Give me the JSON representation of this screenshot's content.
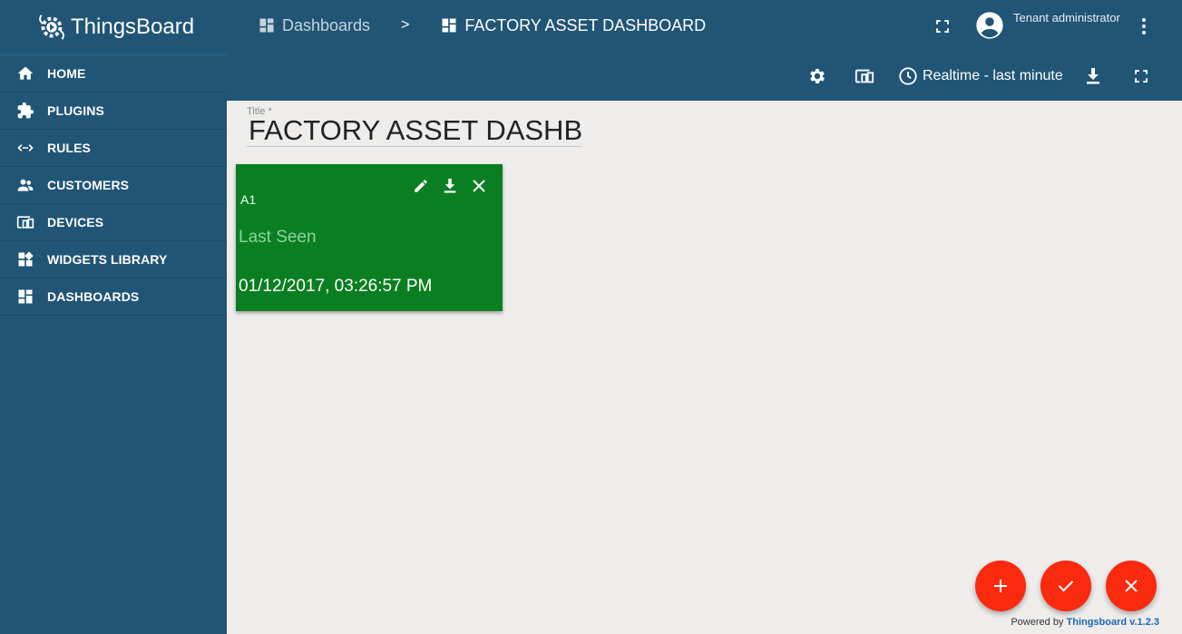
{
  "app": {
    "name": "ThingsBoard"
  },
  "sidebar": {
    "items": [
      {
        "label": "HOME",
        "icon": "home-icon"
      },
      {
        "label": "PLUGINS",
        "icon": "puzzle-icon"
      },
      {
        "label": "RULES",
        "icon": "code-arrows-icon"
      },
      {
        "label": "CUSTOMERS",
        "icon": "people-icon"
      },
      {
        "label": "DEVICES",
        "icon": "devices-icon"
      },
      {
        "label": "WIDGETS LIBRARY",
        "icon": "widgets-icon"
      },
      {
        "label": "DASHBOARDS",
        "icon": "dashboard-icon"
      }
    ]
  },
  "header": {
    "breadcrumb": {
      "parent": "Dashboards",
      "separator": ">",
      "current": "FACTORY ASSET DASHBOARD"
    },
    "user": {
      "name": "Tenant administrator"
    },
    "timewindow": "Realtime - last minute"
  },
  "main": {
    "title_label": "Title *",
    "title_value": "FACTORY ASSET DASHBOARD",
    "widget": {
      "title": "A1",
      "label": "Last Seen",
      "value": "01/12/2017, 03:26:57 PM",
      "color": "#0a7f22"
    }
  },
  "footer": {
    "prefix": "Powered by ",
    "link": "Thingsboard v.1.2.3"
  },
  "colors": {
    "primary": "#215576",
    "accent": "#fa2a0f",
    "background": "#eeedec"
  }
}
